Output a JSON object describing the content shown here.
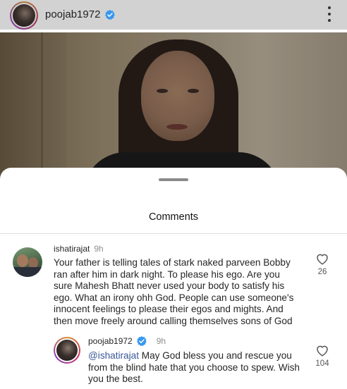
{
  "post": {
    "username": "poojab1972",
    "verified": true
  },
  "comments_sheet": {
    "title": "Comments",
    "comments": [
      {
        "username": "ishatirajat",
        "time": "9h",
        "text": "Your father is telling tales of stark naked parveen Bobby ran after him in dark night. To please his ego. Are you sure Mahesh Bhatt never used your body to satisfy his ego. What an irony ohh God. People can use someone's innocent feelings to please their egos and mights. And then move freely around calling themselves sons of God",
        "likes": "26"
      }
    ],
    "reply": {
      "username": "poojab1972",
      "verified": true,
      "time": "9h",
      "mention": "@ishatirajat",
      "text": " May God bless you and rescue you from the blind hate that you choose to spew. Wish you the best.",
      "likes": "104"
    }
  },
  "colors": {
    "verified_badge": "#3897f0",
    "mention": "#385898",
    "meta_gray": "#8e8e8e"
  },
  "icons": {
    "verified": "verified-badge-icon",
    "more": "more-vertical-icon",
    "like": "heart-outline-icon"
  }
}
